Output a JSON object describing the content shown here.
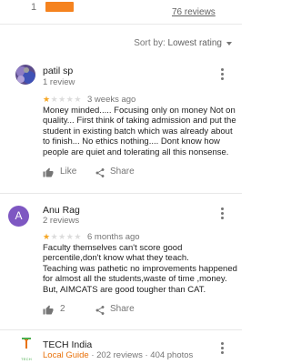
{
  "rating_summary": {
    "row_label": "1",
    "bar_fraction": 1.0,
    "total_reviews_link": "76 reviews"
  },
  "sort": {
    "prefix": "Sort by:",
    "value": "Lowest rating"
  },
  "reviews": [
    {
      "name": "patil sp",
      "review_count": "1 review",
      "stars": 1,
      "time": "3 weeks ago",
      "text": [
        "Money minded..... Focusing only on money Not on quality... First think of taking admission and put the student in existing batch which was already about to finish... No ethics nothing.... Dont know how people are quiet and tolerating all this nonsense."
      ],
      "like_label": "Like",
      "share_label": "Share"
    },
    {
      "name": "Anu Rag",
      "review_count": "2 reviews",
      "avatar_letter": "A",
      "stars": 1,
      "time": "6 months ago",
      "text": [
        "Faculty themselves can't score good percentile,don't know what they teach.",
        "Teaching was pathetic no improvements happened for almost all the students,waste of time ,money. But, AIMCATS are good tougher than CAT."
      ],
      "like_count": "2",
      "share_label": "Share"
    },
    {
      "name": "TECH India",
      "badge": "Local Guide",
      "meta": "· 202 reviews · 404 photos",
      "logo_text": "TECH"
    }
  ],
  "colors": {
    "accent_orange": "#f5831f",
    "star": "#f5a623",
    "avatar_purple": "#7e57c2",
    "local_guide": "#e8710a"
  }
}
